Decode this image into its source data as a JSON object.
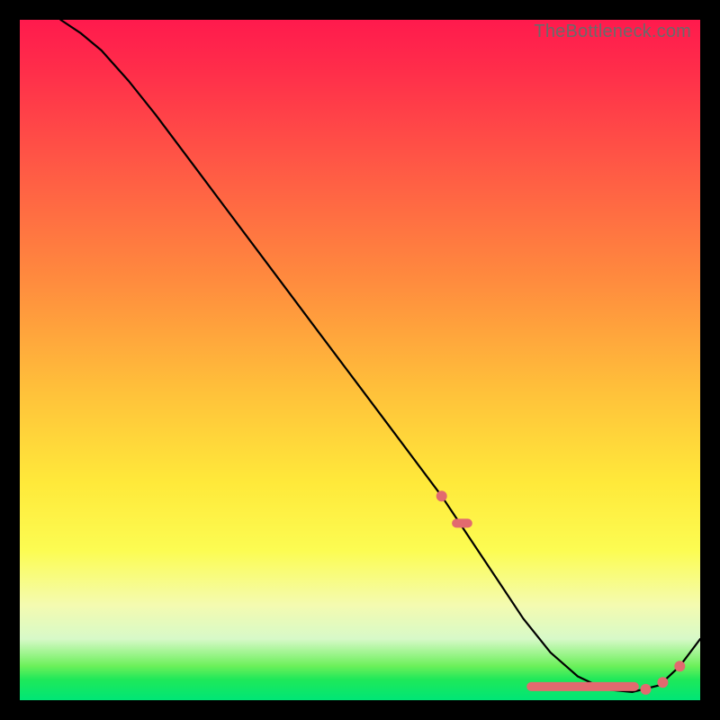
{
  "watermark": "TheBottleneck.com",
  "colors": {
    "curve": "#000000",
    "marker": "#e26a6f"
  },
  "chart_data": {
    "type": "line",
    "title": "",
    "xlabel": "",
    "ylabel": "",
    "xlim": [
      0,
      100
    ],
    "ylim": [
      0,
      100
    ],
    "series": [
      {
        "name": "curve",
        "x": [
          6,
          9,
          12,
          16,
          20,
          26,
          32,
          38,
          44,
          50,
          56,
          62,
          66,
          70,
          74,
          78,
          82,
          86,
          90,
          94,
          97,
          100
        ],
        "y": [
          100,
          98,
          95.5,
          91,
          86,
          78,
          70,
          62,
          54,
          46,
          38,
          30,
          24,
          18,
          12,
          7,
          3.5,
          1.6,
          1.2,
          2.2,
          5,
          9
        ]
      }
    ],
    "markers": {
      "dots_x": [
        62,
        92,
        94.5,
        97
      ],
      "dots_y": [
        30,
        1.6,
        2.6,
        5
      ],
      "dash_segments": [
        {
          "x0": 63.5,
          "x1": 66.5,
          "y": 26
        },
        {
          "x0": 74.5,
          "x1": 91.0,
          "y": 2.0
        }
      ]
    }
  }
}
